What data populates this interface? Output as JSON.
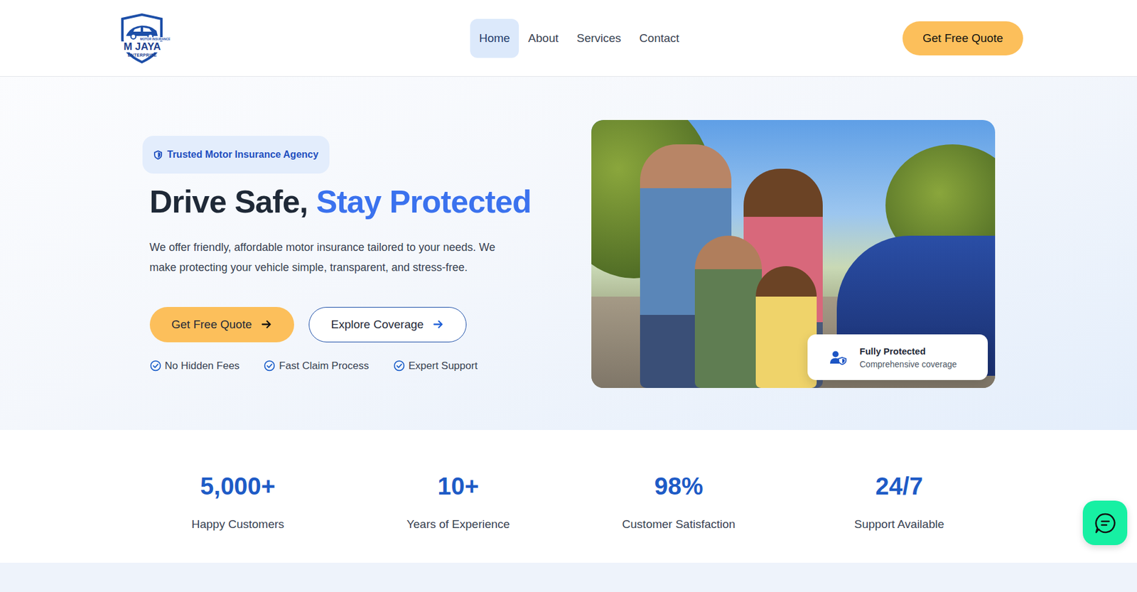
{
  "logo": {
    "title": "M JAYA",
    "tag": "MOTOR INSURANCE",
    "subtitle": "ENTERPRISE"
  },
  "nav": [
    {
      "label": "Home",
      "selected": true
    },
    {
      "label": "About",
      "selected": false
    },
    {
      "label": "Services",
      "selected": false
    },
    {
      "label": "Contact",
      "selected": false
    }
  ],
  "header_button": "Get Free Quote",
  "hero": {
    "badge": "Trusted Motor Insurance Agency",
    "title": "Drive Safe,",
    "title_highlight": "Stay Protected",
    "description": "We offer friendly, affordable motor insurance tailored to your needs. We make protecting your vehicle simple, transparent, and stress-free.",
    "buttons": [
      {
        "label": "Get Free Quote",
        "kind": "primary"
      },
      {
        "label": "Explore Coverage",
        "kind": "outline"
      }
    ],
    "features": [
      "No Hidden Fees",
      "Fast Claim Process",
      "Expert Support"
    ]
  },
  "photo_card": {
    "title": "Fully Protected",
    "subtitle": "Comprehensive coverage"
  },
  "stats": [
    {
      "value": "5,000+",
      "label": "Happy Customers"
    },
    {
      "value": "10+",
      "label": "Years of Experience"
    },
    {
      "value": "98%",
      "label": "Customer Satisfaction"
    },
    {
      "value": "24/7",
      "label": "Support Available"
    }
  ]
}
